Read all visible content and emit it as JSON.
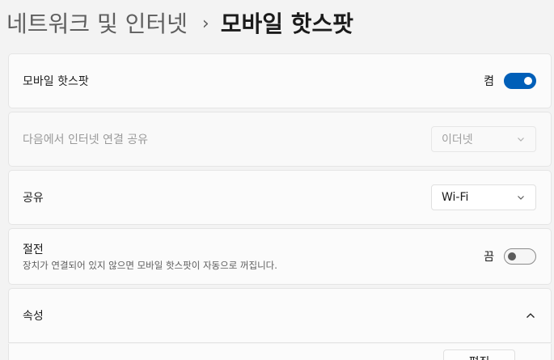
{
  "breadcrumb": {
    "parent": "네트워크 및 인터넷",
    "separator": "›",
    "current": "모바일 핫스팟"
  },
  "hotspot": {
    "label": "모바일 핫스팟",
    "state_label": "켬",
    "on": true
  },
  "share_from": {
    "label": "다음에서 인터넷 연결 공유",
    "value": "이더넷",
    "disabled": true
  },
  "share_over": {
    "label": "공유",
    "value": "Wi-Fi"
  },
  "power_saving": {
    "label": "절전",
    "description": "장치가 연결되어 있지 않으면 모바일 핫스팟이 자동으로 꺼집니다.",
    "state_label": "끔",
    "on": false
  },
  "properties": {
    "label": "속성",
    "expanded": true
  },
  "properties_row": {
    "button_label": "편집"
  },
  "colors": {
    "accent": "#005fb8"
  }
}
